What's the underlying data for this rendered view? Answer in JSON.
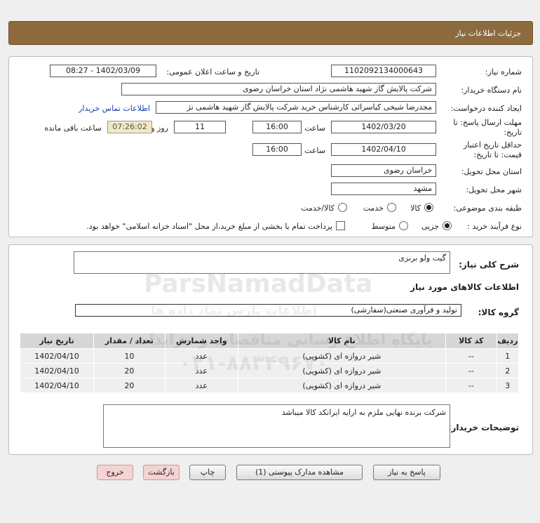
{
  "page_title": "جزئیات اطلاعات نیاز",
  "fields": {
    "need_number_label": "شماره نیاز:",
    "need_number": "1102092134000643",
    "announce_label": "تاریخ و ساعت اعلان عمومی:",
    "announce_value": "1402/03/09 - 08:27",
    "buyer_org_label": "نام دستگاه خریدار:",
    "buyer_org": "شرکت پالایش گاز شهید هاشمی نژاد   استان خراسان رضوی",
    "requester_label": "ایجاد کننده درخواست:",
    "requester": "مجدرضا شیخی کیاسرائی کارشناس خرید شرکت پالایش گاز شهید هاشمی نژ",
    "contact_link": "اطلاعات تماس خریدار",
    "deadline_label_1": "مهلت ارسال پاسخ: تا",
    "deadline_label_2": "تاریخ:",
    "deadline_date": "1402/03/20",
    "time_label": "ساعت",
    "deadline_time": "16:00",
    "days_value": "11",
    "days_label": "روز و",
    "remaining_time": "07:26:02",
    "remaining_label": "ساعت باقی مانده",
    "validity_label_1": "حداقل تاریخ اعتبار",
    "validity_label_2": "قیمت: تا تاریخ:",
    "validity_date": "1402/04/10",
    "validity_time": "16:00",
    "province_label": "استان محل تحویل:",
    "province": "خراسان رضوی",
    "city_label": "شهر محل تحویل:",
    "city": "مشهد",
    "category_label": "طبقه بندی موضوعی:",
    "category_options": [
      "کالا",
      "خدمت",
      "کالا/خدمت"
    ],
    "process_label": "نوع فرآیند خرید :",
    "process_options": [
      "جزیی",
      "متوسط"
    ],
    "payment_note": "پرداخت تمام یا بخشی از مبلغ خرید،از محل \"اسناد خزانه اسلامی\" خواهد بود."
  },
  "summary": {
    "description_label": "شرح کلی نیاز:",
    "description": "گیت ولو برنزی",
    "goods_info_title": "اطلاعات کالاهای مورد نیاز",
    "group_label": "گروه کالا:",
    "group_value": "تولید و فرآوری صنعتی(سفارشی)"
  },
  "table": {
    "headers": [
      "ردیف",
      "کد کالا",
      "نام کالا",
      "واحد شمارش",
      "تعداد / مقدار",
      "تاریخ نیاز"
    ],
    "rows": [
      [
        "1",
        "--",
        "شیر دروازه ای (کشویی)",
        "عدد",
        "10",
        "1402/04/10"
      ],
      [
        "2",
        "--",
        "شیر دروازه ای (کشویی)",
        "عدد",
        "20",
        "1402/04/10"
      ],
      [
        "3",
        "--",
        "شیر دروازه ای (کشویی)",
        "عدد",
        "20",
        "1402/04/10"
      ]
    ]
  },
  "buyer_notes": {
    "label": "توضیحات خریدار:",
    "text": "شرکت برنده نهایی ملزم به ارایه ایرانکد کالا میباشد"
  },
  "buttons": {
    "reply": "پاسخ به نیاز",
    "attachments": "مشاهده مدارک پیوستی (1)",
    "print": "چاپ",
    "back": "بازگشت",
    "exit": "خروج"
  },
  "watermark": {
    "brand": "ParsNamadData",
    "phone": "۰۲۱-۸۸۳۴۹۶۷۰",
    "fa1": "پایگاه اطلاع رسانی مناقصات و مزایدات",
    "fa2": "اطلاعات پارس نماد داده ها"
  },
  "colors": {
    "header": "#8d6b3f",
    "link": "#1b3fa8",
    "remaining_bg": "#f2e9c3"
  }
}
